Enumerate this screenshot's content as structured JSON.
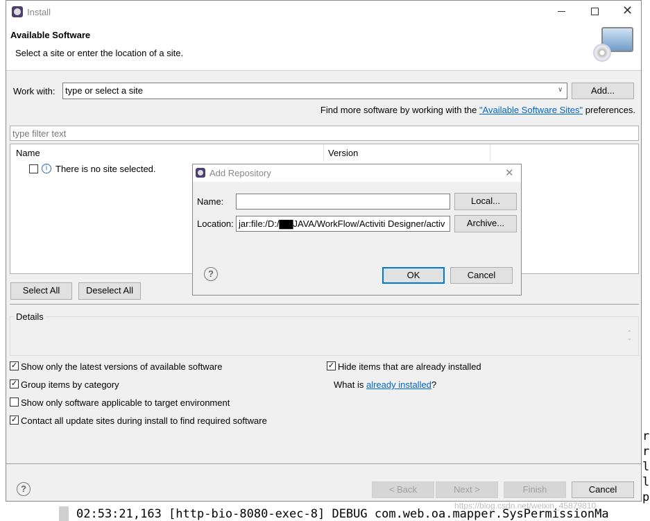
{
  "window": {
    "title": "Install",
    "header_title": "Available Software",
    "header_subtitle": "Select a site or enter the location of a site.",
    "icon": "install-software-icon"
  },
  "work_with": {
    "label": "Work with:",
    "placeholder": "type or select a site",
    "add_label": "Add...",
    "hint_prefix": "Find more software by working with the ",
    "hint_link": "\"Available Software Sites\"",
    "hint_suffix": " preferences."
  },
  "filter": {
    "placeholder": "type filter text"
  },
  "tree": {
    "columns": [
      "Name",
      "Version"
    ],
    "rows": [
      {
        "label": "There is no site selected.",
        "checked": false
      }
    ]
  },
  "buttons": {
    "select_all": "Select All",
    "deselect_all": "Deselect All",
    "back": "< Back",
    "next": "Next >",
    "finish": "Finish",
    "cancel": "Cancel"
  },
  "details": {
    "label": "Details"
  },
  "options": {
    "left": [
      {
        "label": "Show only the latest versions of available software",
        "checked": true
      },
      {
        "label": "Group items by category",
        "checked": true
      },
      {
        "label": "Show only software applicable to target environment",
        "checked": false
      },
      {
        "label": "Contact all update sites during install to find required software",
        "checked": true
      }
    ],
    "hide_installed": {
      "label": "Hide items that are already installed",
      "checked": true
    },
    "what_is_prefix": "What is ",
    "what_is_link": "already installed",
    "what_is_suffix": "?"
  },
  "add_repository": {
    "title": "Add Repository",
    "name_label": "Name:",
    "name_value": "",
    "location_label": "Location:",
    "location_value": "jar:file:/D:/▇▇JAVA/WorkFlow/Activiti Designer/activ",
    "local_label": "Local...",
    "archive_label": "Archive...",
    "ok_label": "OK",
    "cancel_label": "Cancel"
  },
  "background": {
    "console_line": "02:53:21,163 [http-bio-8080-exec-8] DEBUG com.web.oa.mapper.SysPermissionMa",
    "side_chars": [
      "r",
      "r",
      "l",
      "l",
      "p"
    ],
    "watermark": "https://blog.csdn.net/weixin_45879810"
  },
  "colors": {
    "link": "#0066cc",
    "focus": "#0078d7",
    "dialog_bg": "#f0f0f0"
  }
}
